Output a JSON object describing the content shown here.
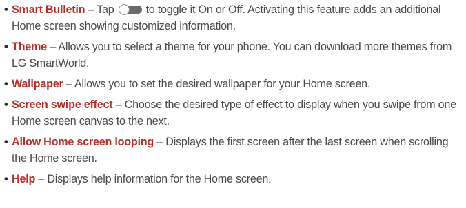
{
  "colors": {
    "term": "#b5302a",
    "body_text": "#4a4a4a",
    "toggle_track": "#6b6b6b"
  },
  "bullet_char": "•",
  "items": [
    {
      "term": "Smart Bulletin",
      "sep": " – ",
      "text_before_icon": "Tap",
      "icon": "toggle-switch-icon",
      "text": "to toggle it On or Off. Activating this feature adds an additional Home screen showing customized information."
    },
    {
      "term": "Theme",
      "sep": " – ",
      "text": "Allows you to select a theme for your phone. You can download more themes from LG SmartWorld."
    },
    {
      "term": "Wallpaper",
      "sep": " – ",
      "text": "Allows you to set the desired wallpaper for your Home screen."
    },
    {
      "term": "Screen swipe effect",
      "sep": " – ",
      "text": "Choose the desired type of effect to display when you swipe from one Home screen canvas to the next."
    },
    {
      "term": "Allow Home screen looping",
      "sep": " – ",
      "text": "Displays the first screen after the last screen when scrolling the Home screen."
    },
    {
      "term": "Help",
      "sep": " – ",
      "text": "Displays help information for the Home screen."
    }
  ]
}
